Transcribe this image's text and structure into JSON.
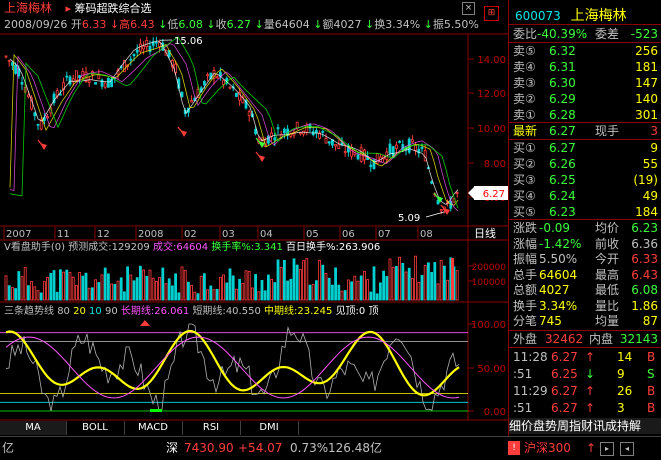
{
  "header": {
    "name": "上海梅林",
    "indicator_menu": "筹码超跌综合选",
    "date": "2008/09/26",
    "open_label": "开",
    "open": "6.33",
    "high_label": "高",
    "high": "6.43",
    "low_label": "低",
    "low": "6.08",
    "close_label": "收",
    "close": "6.27",
    "vol_label": "量",
    "vol": "64604",
    "amt_label": "额",
    "amt": "4027",
    "turnover_label": "换",
    "turnover": "3.34%",
    "amp_label": "振",
    "amp": "5.50%"
  },
  "price_chart": {
    "y_ticks": [
      "14.00",
      "12.00",
      "10.00",
      "8.00",
      "6.00"
    ],
    "high_label": "15.06",
    "low_label": "5.09",
    "last_price": "6.27",
    "x_ticks": [
      "2007",
      "11",
      "12",
      "2008",
      "02",
      "03",
      "04",
      "05",
      "06",
      "07",
      "08"
    ],
    "line_tab": "日线"
  },
  "volume_panel": {
    "title": "V看盘助手(0)",
    "forecast_label": "预测成交:",
    "forecast": "129209",
    "vol_label": "成交:",
    "vol": "64604",
    "turn_label": "换手率%:",
    "turn": "3.341",
    "avg_label": "百日换手%:",
    "avg": "263.906",
    "y_ticks": [
      "200000",
      "100000"
    ]
  },
  "trend_panel": {
    "title": "三条趋势线",
    "p1": "80",
    "p2": "20",
    "p3": "10",
    "p4": "90",
    "long_label": "长期线:",
    "long": "26.061",
    "short_label": "短期线:",
    "short": "40.550",
    "mid_label": "中期线:",
    "mid": "23.245",
    "top_label": "见顶:0",
    "top2": "顶",
    "y_ticks": [
      "100.00",
      "50.00",
      "0.00"
    ]
  },
  "tabs": [
    "MA",
    "BOLL",
    "MACD",
    "RSI",
    "DMI"
  ],
  "quote": {
    "code": "600073",
    "name": "上海梅林",
    "weibi_label": "委比",
    "weibi": "-40.39%",
    "weicha_label": "委差",
    "weicha": "-523",
    "sell": [
      {
        "label": "卖⑤",
        "price": "6.32",
        "vol": "256"
      },
      {
        "label": "卖④",
        "price": "6.31",
        "vol": "181"
      },
      {
        "label": "卖③",
        "price": "6.30",
        "vol": "147"
      },
      {
        "label": "卖②",
        "price": "6.29",
        "vol": "140"
      },
      {
        "label": "卖①",
        "price": "6.28",
        "vol": "301"
      }
    ],
    "last_label": "最新",
    "last": "6.27",
    "hand_label": "现手",
    "hand": "3",
    "buy": [
      {
        "label": "买①",
        "price": "6.27",
        "vol": "9"
      },
      {
        "label": "买②",
        "price": "6.26",
        "vol": "55"
      },
      {
        "label": "买③",
        "price": "6.25",
        "vol": "(19)"
      },
      {
        "label": "买④",
        "price": "6.24",
        "vol": "49"
      },
      {
        "label": "买⑤",
        "price": "6.23",
        "vol": "184"
      }
    ],
    "stats": [
      {
        "l1": "涨跌",
        "v1": "-0.09",
        "l2": "均价",
        "v2": "6.23"
      },
      {
        "l1": "涨幅",
        "v1": "-1.42%",
        "l2": "前收",
        "v2": "6.36"
      },
      {
        "l1": "振幅",
        "v1": "5.50%",
        "l2": "今开",
        "v2": "6.33"
      },
      {
        "l1": "总手",
        "v1": "64604",
        "l2": "最高",
        "v2": "6.43"
      },
      {
        "l1": "总额",
        "v1": "4027",
        "l2": "最低",
        "v2": "6.08"
      },
      {
        "l1": "换手",
        "v1": "3.34%",
        "l2": "量比",
        "v2": "1.86"
      },
      {
        "l1": "分笔",
        "v1": "745",
        "l2": "均量",
        "v2": "87"
      }
    ],
    "outer_label": "外盘",
    "outer": "32462",
    "inner_label": "内盘",
    "inner": "32143",
    "ticks": [
      {
        "time": "11:28",
        "price": "6.27",
        "vol": "14",
        "dir": "B"
      },
      {
        "time": ":51",
        "price": "6.25",
        "vol": "9",
        "dir": "S"
      },
      {
        "time": "11:29",
        "price": "6.27",
        "vol": "26",
        "dir": "B"
      },
      {
        "time": ":51",
        "price": "6.27",
        "vol": "3",
        "dir": "B"
      }
    ],
    "tabs_bottom": "细价盘势周指财讯成持解"
  },
  "status": {
    "left": "亿",
    "sz_label": "深",
    "sz_index": "7430.90",
    "sz_change": "+54.07",
    "sz_pct": "0.73%",
    "sz_amt": "126.48亿",
    "sh_label": "沪深300",
    "sh_arrow": "↑"
  }
}
